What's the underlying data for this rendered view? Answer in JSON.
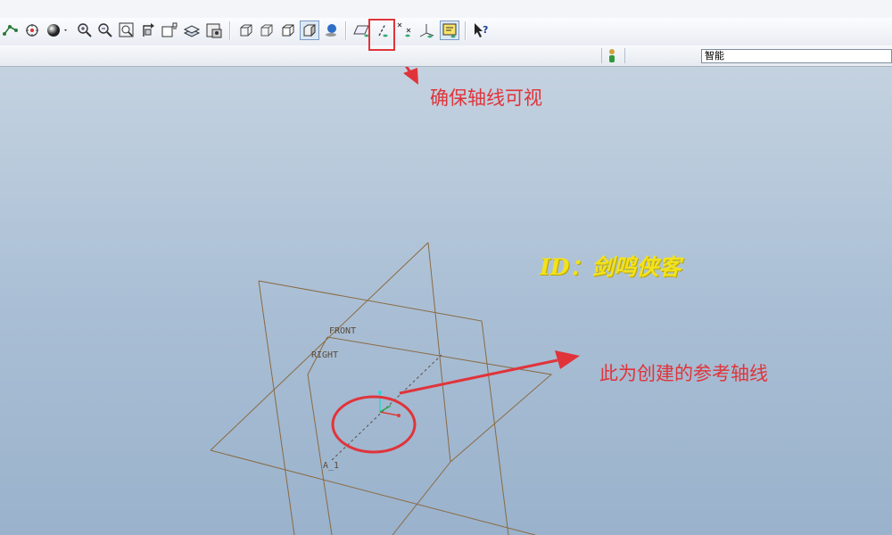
{
  "toolbar": {
    "buttons": [
      {
        "icon": "sketch-display-icon"
      },
      {
        "icon": "spin-center-icon"
      },
      {
        "icon": "display-style-icon"
      },
      {
        "icon": "zoom-in-icon"
      },
      {
        "icon": "zoom-out-icon"
      },
      {
        "icon": "refit-icon"
      },
      {
        "icon": "reorient-icon"
      },
      {
        "icon": "saved-views-icon"
      },
      {
        "icon": "layers-icon"
      },
      {
        "icon": "repaint-icon"
      },
      {
        "icon": "wireframe-icon"
      },
      {
        "icon": "hidden-line-icon"
      },
      {
        "icon": "no-hidden-icon"
      },
      {
        "icon": "shading-icon"
      },
      {
        "icon": "enhanced-realism-icon"
      },
      {
        "icon": "datum-plane-display-icon"
      },
      {
        "icon": "datum-axis-display-icon"
      },
      {
        "icon": "datum-point-display-icon"
      },
      {
        "icon": "coordinate-system-display-icon"
      },
      {
        "icon": "annotation-display-icon"
      },
      {
        "icon": "context-help-icon"
      }
    ]
  },
  "status": {
    "indicator_icon": "traffic-light-icon",
    "filter_value": "智能"
  },
  "viewport": {
    "plane_labels": {
      "front": "FRONT",
      "right": "RIGHT",
      "axis": "A_1"
    },
    "colors": {
      "plane_edge": "#8a6a42",
      "annotation_red": "#e0343a",
      "watermark": "#f2e21c"
    }
  },
  "annotations": {
    "top_callout": "确保轴线可视",
    "axis_callout": "此为创建的参考轴线",
    "watermark": "ID：剑鸣侠客"
  }
}
